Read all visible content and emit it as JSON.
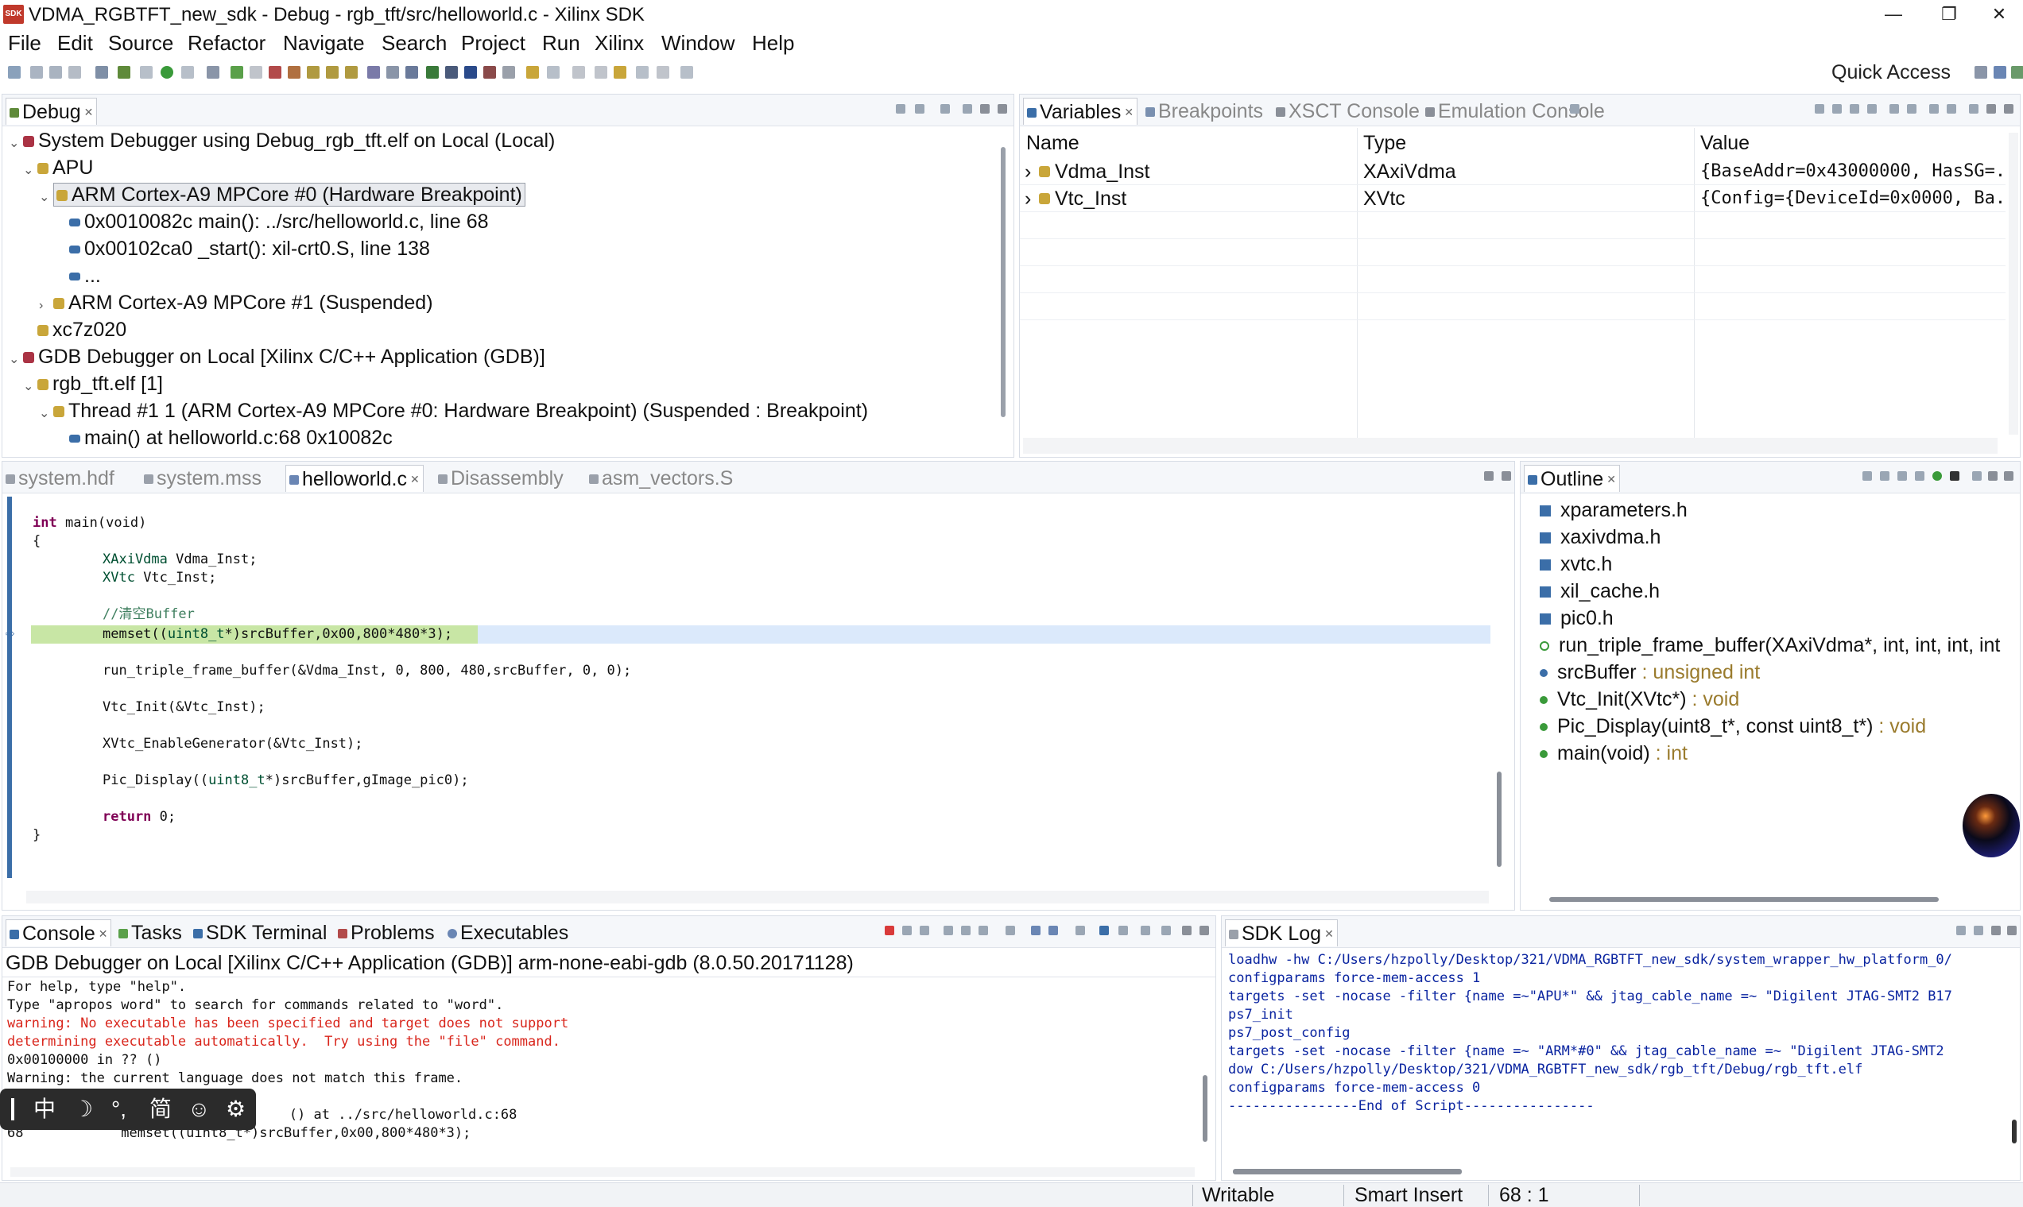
{
  "window": {
    "icon_text": "SDK",
    "title": "VDMA_RGBTFT_new_sdk - Debug - rgb_tft/src/helloworld.c - Xilinx SDK",
    "minimize": "—",
    "maximize": "❐",
    "close": "✕"
  },
  "menu": [
    "File",
    "Edit",
    "Source",
    "Refactor",
    "Navigate",
    "Search",
    "Project",
    "Run",
    "Xilinx",
    "Window",
    "Help"
  ],
  "toolbar": {
    "quick_access": "Quick Access"
  },
  "debug_view": {
    "tab": "Debug",
    "tree": [
      "System Debugger using Debug_rgb_tft.elf on Local (Local)",
      "APU",
      "ARM Cortex-A9 MPCore #0 (Hardware Breakpoint)",
      "0x0010082c main(): ../src/helloworld.c, line 68",
      "0x00102ca0 _start(): xil-crt0.S, line 138",
      "...",
      "ARM Cortex-A9 MPCore #1 (Suspended)",
      "xc7z020",
      "GDB Debugger on Local [Xilinx C/C++ Application (GDB)]",
      "rgb_tft.elf [1]",
      "Thread #1 1 (ARM Cortex-A9 MPCore #0: Hardware Breakpoint) (Suspended : Breakpoint)",
      "main() at helloworld.c:68 0x10082c"
    ]
  },
  "variables_view": {
    "tabs": [
      "Variables",
      "Breakpoints",
      "XSCT Console",
      "Emulation Console"
    ],
    "columns": [
      "Name",
      "Type",
      "Value"
    ],
    "rows": [
      {
        "name": "Vdma_Inst",
        "type": "XAxiVdma",
        "value": "{BaseAddr=0x43000000, HasSG=..."
      },
      {
        "name": "Vtc_Inst",
        "type": "XVtc",
        "value": "{Config={DeviceId=0x0000, Ba..."
      }
    ]
  },
  "editor": {
    "tabs": [
      "system.hdf",
      "system.mss",
      "helloworld.c",
      "Disassembly",
      "asm_vectors.S"
    ],
    "code": {
      "l1_kw": "int",
      "l1_rest": " main(void)",
      "l2": "{",
      "l3_type": "XAxiVdma",
      "l3_rest": " Vdma_Inst;",
      "l4_type": "XVtc",
      "l4_rest": " Vtc_Inst;",
      "l5_comment": "//清空Buffer",
      "l6_a": "memset((",
      "l6_type": "uint8_t",
      "l6_b": "*)srcBuffer,0x00,800*480*3);",
      "l7": "run_triple_frame_buffer(&Vdma_Inst, 0, 800, 480,srcBuffer, 0, 0);",
      "l8": "Vtc_Init(&Vtc_Inst);",
      "l9": "XVtc_EnableGenerator(&Vtc_Inst);",
      "l10_a": "Pic_Display((",
      "l10_type": "uint8_t",
      "l10_b": "*)srcBuffer,gImage_pic0);",
      "l11_kw": "return",
      "l11_rest": " 0;",
      "l12": "}"
    }
  },
  "outline": {
    "tab": "Outline",
    "items": [
      {
        "name": "xparameters.h",
        "type": ""
      },
      {
        "name": "xaxivdma.h",
        "type": ""
      },
      {
        "name": "xvtc.h",
        "type": ""
      },
      {
        "name": "xil_cache.h",
        "type": ""
      },
      {
        "name": "pic0.h",
        "type": ""
      },
      {
        "name": "run_triple_frame_buffer(XAxiVdma*, int, int, int, int",
        "type": ""
      },
      {
        "name": "srcBuffer",
        "type": " : unsigned int"
      },
      {
        "name": "Vtc_Init(XVtc*)",
        "type": " : void"
      },
      {
        "name": "Pic_Display(uint8_t*, const uint8_t*)",
        "type": " : void"
      },
      {
        "name": "main(void)",
        "type": " : int"
      }
    ]
  },
  "console": {
    "tabs": [
      "Console",
      "Tasks",
      "SDK Terminal",
      "Problems",
      "Executables"
    ],
    "header": "GDB Debugger on Local [Xilinx C/C++ Application (GDB)] arm-none-eabi-gdb (8.0.50.20171128)",
    "lines": [
      "For help, type \"help\".",
      "Type \"apropos word\" to search for commands related to \"word\".",
      "warning: No executable has been specified and target does not support",
      "determining executable automatically.  Try using the \"file\" command.",
      "0x00100000 in ?? ()",
      "Warning: the current language does not match this frame.",
      "",
      "            () at ../src/helloworld.c:68",
      "68            memset((uint8_t*)srcBuffer,0x00,800*480*3);"
    ]
  },
  "sdk_log": {
    "tab": "SDK Log",
    "lines": [
      "loadhw -hw C:/Users/hzpolly/Desktop/321/VDMA_RGBTFT_new_sdk/system_wrapper_hw_platform_0/",
      "configparams force-mem-access 1",
      "targets -set -nocase -filter {name =~\"APU*\" && jtag_cable_name =~ \"Digilent JTAG-SMT2 B17",
      "ps7_init",
      "ps7_post_config",
      "targets -set -nocase -filter {name =~ \"ARM*#0\" && jtag_cable_name =~ \"Digilent JTAG-SMT2",
      "dow C:/Users/hzpolly/Desktop/321/VDMA_RGBTFT_new_sdk/rgb_tft/Debug/rgb_tft.elf",
      "configparams force-mem-access 0",
      "----------------End of Script----------------"
    ]
  },
  "ime": {
    "items": [
      "中",
      "☽",
      "°,",
      "简",
      "☺",
      "⚙"
    ]
  },
  "status": {
    "writable": "Writable",
    "insert_mode": "Smart Insert",
    "position": "68 : 1"
  },
  "colors": {
    "accent": "#3b6ea8",
    "highlight_line": "#c8e6a5",
    "error_text": "#d9261c",
    "log_text": "#0a24a0"
  }
}
